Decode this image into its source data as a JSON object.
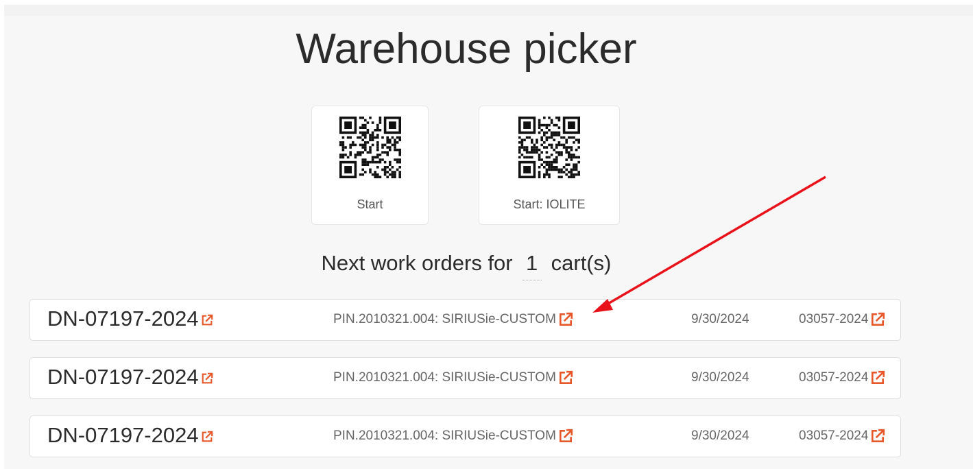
{
  "page": {
    "title": "Warehouse picker"
  },
  "qr_cards": [
    {
      "label": "Start"
    },
    {
      "label": "Start: IOLITE"
    }
  ],
  "next_orders": {
    "prefix": "Next work orders for",
    "cart_count": "1",
    "suffix": "cart(s)"
  },
  "orders": [
    {
      "dn": "DN-07197-2024",
      "pin": "PIN.2010321.004: SIRIUSie-CUSTOM",
      "date": "9/30/2024",
      "ref": "03057-2024"
    },
    {
      "dn": "DN-07197-2024",
      "pin": "PIN.2010321.004: SIRIUSie-CUSTOM",
      "date": "9/30/2024",
      "ref": "03057-2024"
    },
    {
      "dn": "DN-07197-2024",
      "pin": "PIN.2010321.004: SIRIUSie-CUSTOM",
      "date": "9/30/2024",
      "ref": "03057-2024"
    }
  ],
  "colors": {
    "link_icon": "#e8572a",
    "annotation_arrow": "#e8121a",
    "background": "#f7f7f7"
  },
  "icons": {
    "link": "external-link-icon",
    "qr": "qr-code-icon"
  }
}
